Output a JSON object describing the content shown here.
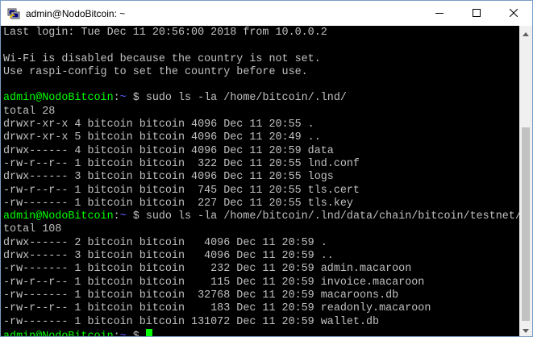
{
  "window": {
    "title": "admin@NodoBitcoin: ~"
  },
  "icons": {
    "app": "putty-icon",
    "minimize": "minimize-icon",
    "maximize": "maximize-icon",
    "close": "close-icon",
    "scroll_up": "scroll-up-icon",
    "scroll_down": "scroll-down-icon"
  },
  "colors": {
    "prompt_user": "#00ff00",
    "prompt_path": "#5c5cff",
    "output_text": "#c0c0c0",
    "background": "#000000",
    "cursor": "#00ff00"
  },
  "prompt": {
    "user_host": "admin@NodoBitcoin",
    "separator": ":",
    "path": "~",
    "symbol": " $ "
  },
  "scroll": {
    "thumb_start": 0.31,
    "thumb_size": 0.69
  },
  "terminal": {
    "lines": [
      {
        "kind": "text",
        "text": "Last login: Tue Dec 11 20:56:00 2018 from 10.0.0.2"
      },
      {
        "kind": "text",
        "text": ""
      },
      {
        "kind": "text",
        "text": "Wi-Fi is disabled because the country is not set."
      },
      {
        "kind": "text",
        "text": "Use raspi-config to set the country before use."
      },
      {
        "kind": "text",
        "text": ""
      },
      {
        "kind": "prompt",
        "command": "sudo ls -la /home/bitcoin/.lnd/"
      },
      {
        "kind": "text",
        "text": "total 28"
      },
      {
        "kind": "text",
        "text": "drwxr-xr-x 4 bitcoin bitcoin 4096 Dec 11 20:55 ."
      },
      {
        "kind": "text",
        "text": "drwxr-xr-x 5 bitcoin bitcoin 4096 Dec 11 20:49 .."
      },
      {
        "kind": "text",
        "text": "drwx------ 4 bitcoin bitcoin 4096 Dec 11 20:59 data"
      },
      {
        "kind": "text",
        "text": "-rw-r--r-- 1 bitcoin bitcoin  322 Dec 11 20:55 lnd.conf"
      },
      {
        "kind": "text",
        "text": "drwx------ 3 bitcoin bitcoin 4096 Dec 11 20:55 logs"
      },
      {
        "kind": "text",
        "text": "-rw-r--r-- 1 bitcoin bitcoin  745 Dec 11 20:55 tls.cert"
      },
      {
        "kind": "text",
        "text": "-rw------- 1 bitcoin bitcoin  227 Dec 11 20:55 tls.key"
      },
      {
        "kind": "prompt",
        "command": "sudo ls -la /home/bitcoin/.lnd/data/chain/bitcoin/testnet/"
      },
      {
        "kind": "text",
        "text": "total 108"
      },
      {
        "kind": "text",
        "text": "drwx------ 2 bitcoin bitcoin   4096 Dec 11 20:59 ."
      },
      {
        "kind": "text",
        "text": "drwx------ 3 bitcoin bitcoin   4096 Dec 11 20:59 .."
      },
      {
        "kind": "text",
        "text": "-rw------- 1 bitcoin bitcoin    232 Dec 11 20:59 admin.macaroon"
      },
      {
        "kind": "text",
        "text": "-rw-r--r-- 1 bitcoin bitcoin    115 Dec 11 20:59 invoice.macaroon"
      },
      {
        "kind": "text",
        "text": "-rw------- 1 bitcoin bitcoin  32768 Dec 11 20:59 macaroons.db"
      },
      {
        "kind": "text",
        "text": "-rw-r--r-- 1 bitcoin bitcoin    183 Dec 11 20:59 readonly.macaroon"
      },
      {
        "kind": "text",
        "text": "-rw------- 1 bitcoin bitcoin 131072 Dec 11 20:59 wallet.db"
      },
      {
        "kind": "prompt",
        "command": "",
        "cursor": true
      }
    ]
  }
}
